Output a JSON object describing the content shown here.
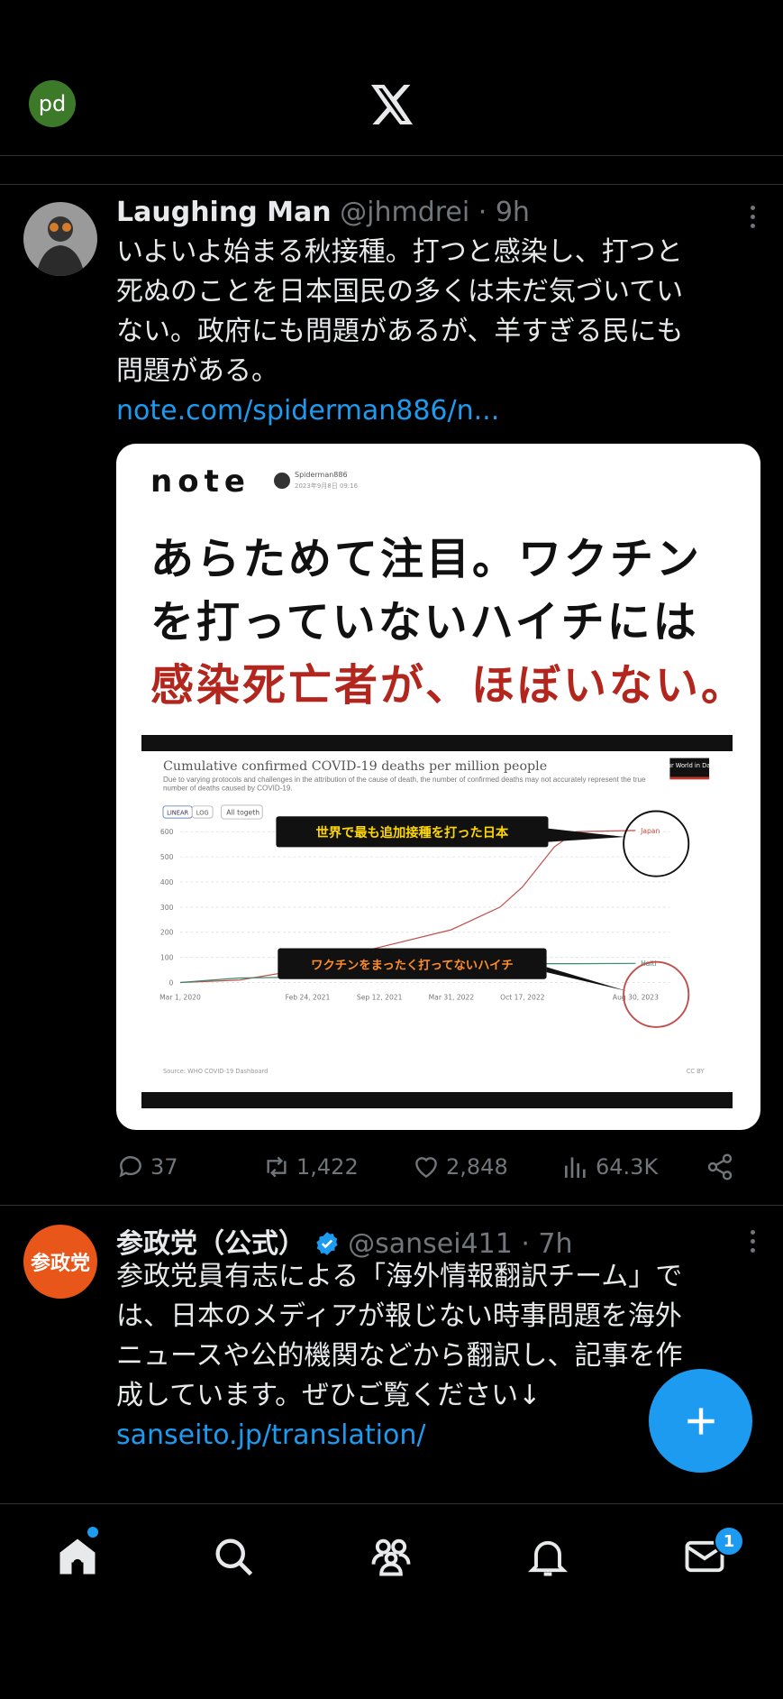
{
  "header": {
    "avatar_initials": "pd",
    "logo": "x-logo-icon"
  },
  "tweets": [
    {
      "name": "Laughing Man",
      "handle": "@jhmdrei",
      "time": "· 9h",
      "text_lines": [
        "いよいよ始まる秋接種。打つと感染し、打つと",
        "死ぬのことを日本国民の多くは未だ気づいてい",
        "ない。政府にも問題があるが、羊すぎる民にも",
        "問題がある。"
      ],
      "link": "note.com/spiderman886/n...",
      "media": {
        "brand": "note",
        "author": "Spiderman886",
        "date": "2023年9月8日 09:16",
        "headline_lines": [
          "あらためて注目。ワクチン",
          "を打っていないハイチには",
          "感染死亡者が、ほぼいない。"
        ],
        "callout_top": "世界で最も追加接種を打った日本",
        "callout_bottom": "ワクチンをまったく打ってないハイチ"
      },
      "actions": {
        "replies": "37",
        "reposts": "1,422",
        "likes": "2,848",
        "views": "64.3K"
      }
    },
    {
      "name": "参政党（公式）",
      "handle": "@sansei411",
      "time": "· 7h",
      "avatar_text": "参政党",
      "text_lines": [
        "参政党員有志による「海外情報翻訳チーム」で",
        "は、日本のメディアが報じない時事問題を海外",
        "ニュースや公的機関などから翻訳し、記事を作",
        "成しています。ぜひご覧ください↓"
      ],
      "link": "sanseito.jp/translation/"
    }
  ],
  "chart_data": {
    "type": "line",
    "title": "Cumulative confirmed COVID-19 deaths per million people",
    "subtitle": "Due to varying protocols and challenges in the attribution of the cause of death, the number of confirmed deaths may not accurately represent the true number of deaths caused by COVID-19.",
    "toggle_linear": "LINEAR",
    "toggle_log": "LOG",
    "selector": "All togeth",
    "source": "Source: WHO COVID-19 Dashboard",
    "license": "CC BY",
    "owid": "Our World in Data",
    "x_ticks": [
      "Mar 1, 2020",
      "Feb 24, 2021",
      "Sep 12, 2021",
      "Mar 31, 2022",
      "Oct 17, 2022",
      "Aug 30, 2023"
    ],
    "y_ticks": [
      "0",
      "100",
      "200",
      "300",
      "400",
      "500",
      "600"
    ],
    "ylim": [
      0,
      600
    ],
    "series": [
      {
        "name": "Japan",
        "color": "#c0504d",
        "x": [
          "Mar 1, 2020",
          "Aug 2020",
          "Feb 24, 2021",
          "May 2021",
          "Sep 12, 2021",
          "Mar 31, 2022",
          "Aug 2022",
          "Oct 17, 2022",
          "Jan 2023",
          "Mar 2023",
          "Aug 30, 2023"
        ],
        "y": [
          0,
          10,
          55,
          100,
          140,
          210,
          300,
          380,
          540,
          600,
          605
        ]
      },
      {
        "name": "Haiti",
        "color": "#3a8a6b",
        "x": [
          "Mar 1, 2020",
          "Aug 2020",
          "Feb 24, 2021",
          "May 2021",
          "Sep 12, 2021",
          "Mar 31, 2022",
          "Aug 2022",
          "Oct 17, 2022",
          "Jan 2023",
          "Mar 2023",
          "Aug 30, 2023"
        ],
        "y": [
          0,
          18,
          22,
          35,
          60,
          70,
          74,
          75,
          75,
          75,
          76
        ]
      }
    ]
  }
}
